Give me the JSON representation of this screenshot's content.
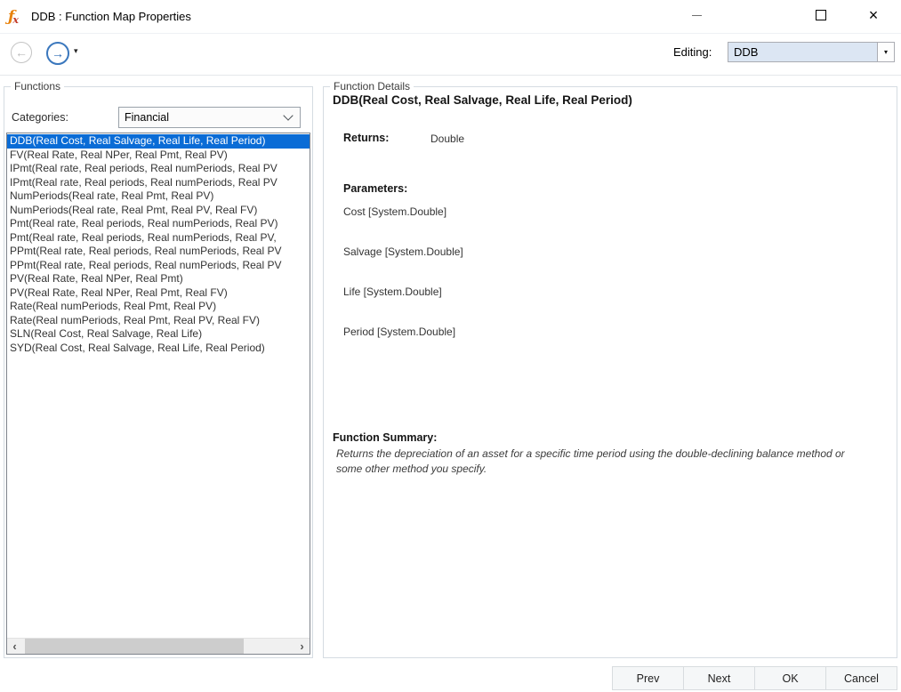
{
  "window": {
    "title": "DDB : Function Map Properties"
  },
  "icons": {
    "app_icon_f": "ƒ",
    "app_icon_x": "x",
    "back_icon": "←",
    "forward_icon": "→",
    "dropdown_caret": "▾",
    "close_icon": "×",
    "scroll_left_icon": "‹",
    "scroll_right_icon": "›"
  },
  "toolbar": {
    "editing_label": "Editing:",
    "editing_value": "DDB"
  },
  "functions_panel": {
    "title": "Functions",
    "categories_label": "Categories:",
    "categories_value": "Financial",
    "selected_index": 0,
    "items": [
      "DDB(Real Cost, Real Salvage, Real Life, Real Period)",
      "FV(Real Rate, Real NPer, Real Pmt, Real PV)",
      "IPmt(Real rate, Real periods, Real numPeriods, Real PV",
      "IPmt(Real rate, Real periods, Real numPeriods, Real PV",
      "NumPeriods(Real rate, Real Pmt, Real PV)",
      "NumPeriods(Real rate, Real Pmt, Real PV, Real FV)",
      "Pmt(Real rate, Real periods, Real numPeriods, Real PV)",
      "Pmt(Real rate, Real periods, Real numPeriods, Real PV,",
      "PPmt(Real rate, Real periods, Real numPeriods, Real PV",
      "PPmt(Real rate, Real periods, Real numPeriods, Real PV",
      "PV(Real Rate, Real NPer, Real Pmt)",
      "PV(Real Rate, Real NPer, Real Pmt, Real FV)",
      "Rate(Real numPeriods, Real Pmt, Real PV)",
      "Rate(Real numPeriods, Real Pmt, Real PV, Real FV)",
      "SLN(Real Cost, Real Salvage, Real Life)",
      "SYD(Real Cost, Real Salvage, Real Life, Real Period)"
    ]
  },
  "details_panel": {
    "title": "Function Details",
    "signature": "DDB(Real Cost, Real Salvage, Real Life, Real Period)",
    "returns_label": "Returns:",
    "returns_value": "Double",
    "parameters_label": "Parameters:",
    "parameters": [
      "Cost [System.Double]",
      "Salvage [System.Double]",
      "Life [System.Double]",
      "Period [System.Double]"
    ],
    "summary_label": "Function Summary:",
    "summary_text": "Returns the depreciation of an asset for a specific time period using the double-declining balance method or some other method you specify."
  },
  "footer": {
    "buttons": [
      "Prev",
      "Next",
      "OK",
      "Cancel"
    ]
  },
  "colors": {
    "selection_blue": "#0a6cd6",
    "forward_accent_blue": "#3a77bd",
    "editing_combo_bg": "#dce6f3",
    "app_icon_orange": "#e8820c",
    "app_icon_red": "#c13a28"
  }
}
